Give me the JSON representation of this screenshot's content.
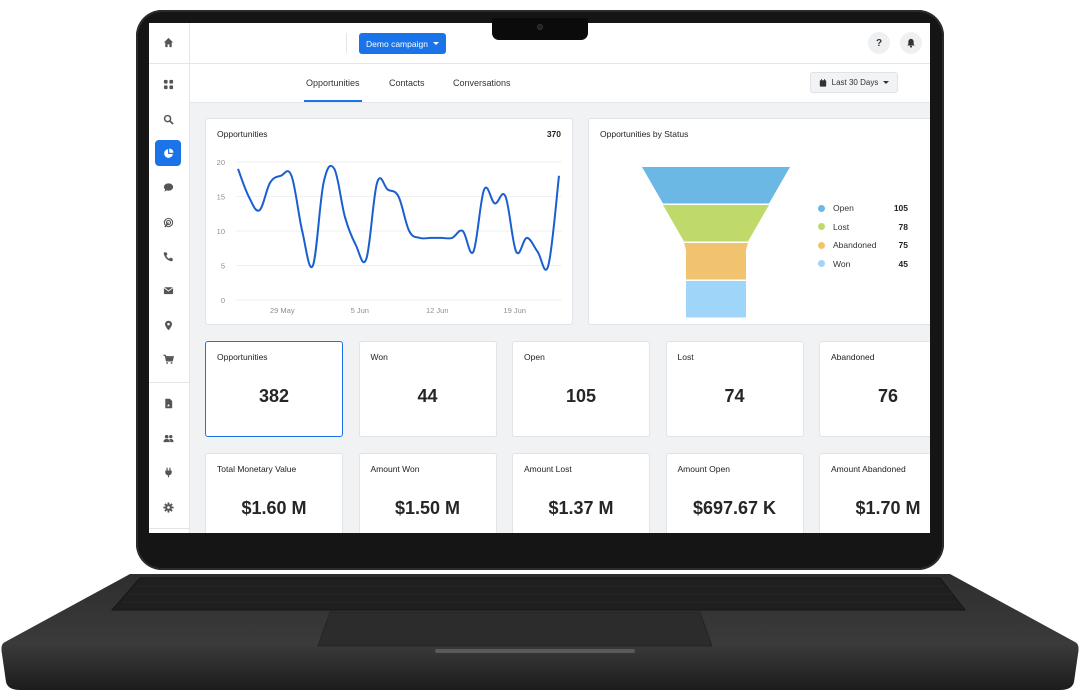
{
  "app": {
    "campaign_button": "Demo campaign",
    "help_label": "?",
    "date_range": "Last 30 Days"
  },
  "sidebar": {
    "items": [
      {
        "icon": "home-icon"
      },
      {
        "icon": "apps-grid-icon"
      },
      {
        "icon": "search-icon"
      },
      {
        "icon": "pie-chart-icon",
        "active": true
      },
      {
        "icon": "chat-bubble-icon"
      },
      {
        "icon": "broadcast-icon"
      },
      {
        "icon": "phone-icon"
      },
      {
        "icon": "mail-icon"
      },
      {
        "icon": "location-pin-icon"
      },
      {
        "icon": "cart-icon"
      },
      {
        "icon": "document-icon"
      },
      {
        "icon": "users-icon"
      },
      {
        "icon": "plug-icon"
      },
      {
        "icon": "gear-icon"
      }
    ]
  },
  "tabs": [
    {
      "label": "Opportunities",
      "active": true
    },
    {
      "label": "Contacts",
      "active": false
    },
    {
      "label": "Conversations",
      "active": false
    }
  ],
  "line_card": {
    "title": "Opportunities",
    "total": "370"
  },
  "funnel_card": {
    "title": "Opportunities by Status"
  },
  "stats_row1": [
    {
      "label": "Opportunities",
      "value": "382",
      "selected": true
    },
    {
      "label": "Won",
      "value": "44"
    },
    {
      "label": "Open",
      "value": "105"
    },
    {
      "label": "Lost",
      "value": "74"
    },
    {
      "label": "Abandoned",
      "value": "76"
    }
  ],
  "stats_row2": [
    {
      "label": "Total Monetary Value",
      "value": "$1.60 M"
    },
    {
      "label": "Amount Won",
      "value": "$1.50 M"
    },
    {
      "label": "Amount Lost",
      "value": "$1.37 M"
    },
    {
      "label": "Amount Open",
      "value": "$697.67 K"
    },
    {
      "label": "Amount Abandoned",
      "value": "$1.70 M"
    }
  ],
  "chart_data": [
    {
      "type": "line",
      "title": "Opportunities",
      "xlabel": "",
      "ylabel": "",
      "ylim": [
        0,
        20
      ],
      "yticks": [
        0,
        5,
        10,
        15,
        20
      ],
      "xtick_labels": [
        "29 May",
        "5 Jun",
        "12 Jun",
        "19 Jun"
      ],
      "xtick_index": [
        4,
        11,
        18,
        25
      ],
      "grid": true,
      "color": "#1a5fd0",
      "x": [
        "25 May",
        "26 May",
        "27 May",
        "28 May",
        "29 May",
        "30 May",
        "31 May",
        "1 Jun",
        "2 Jun",
        "3 Jun",
        "4 Jun",
        "5 Jun",
        "6 Jun",
        "7 Jun",
        "8 Jun",
        "9 Jun",
        "10 Jun",
        "11 Jun",
        "12 Jun",
        "13 Jun",
        "14 Jun",
        "15 Jun",
        "16 Jun",
        "17 Jun",
        "18 Jun",
        "19 Jun",
        "20 Jun",
        "21 Jun",
        "22 Jun",
        "23 Jun"
      ],
      "series": [
        {
          "name": "Opportunities",
          "values": [
            19,
            15,
            13,
            17,
            18,
            18,
            10,
            5,
            17,
            19,
            12,
            8,
            6,
            17,
            16,
            15,
            10,
            9,
            9,
            9,
            9,
            10,
            7,
            16,
            14,
            15,
            7,
            9,
            7,
            5,
            18
          ]
        }
      ]
    },
    {
      "type": "funnel",
      "title": "Opportunities by Status",
      "legend": "right",
      "categories": [
        "Open",
        "Lost",
        "Abandoned",
        "Won"
      ],
      "values": [
        105,
        78,
        75,
        45
      ],
      "colors": [
        "#6cb8e4",
        "#bfd96a",
        "#f1c36e",
        "#9fd5f8"
      ]
    }
  ]
}
